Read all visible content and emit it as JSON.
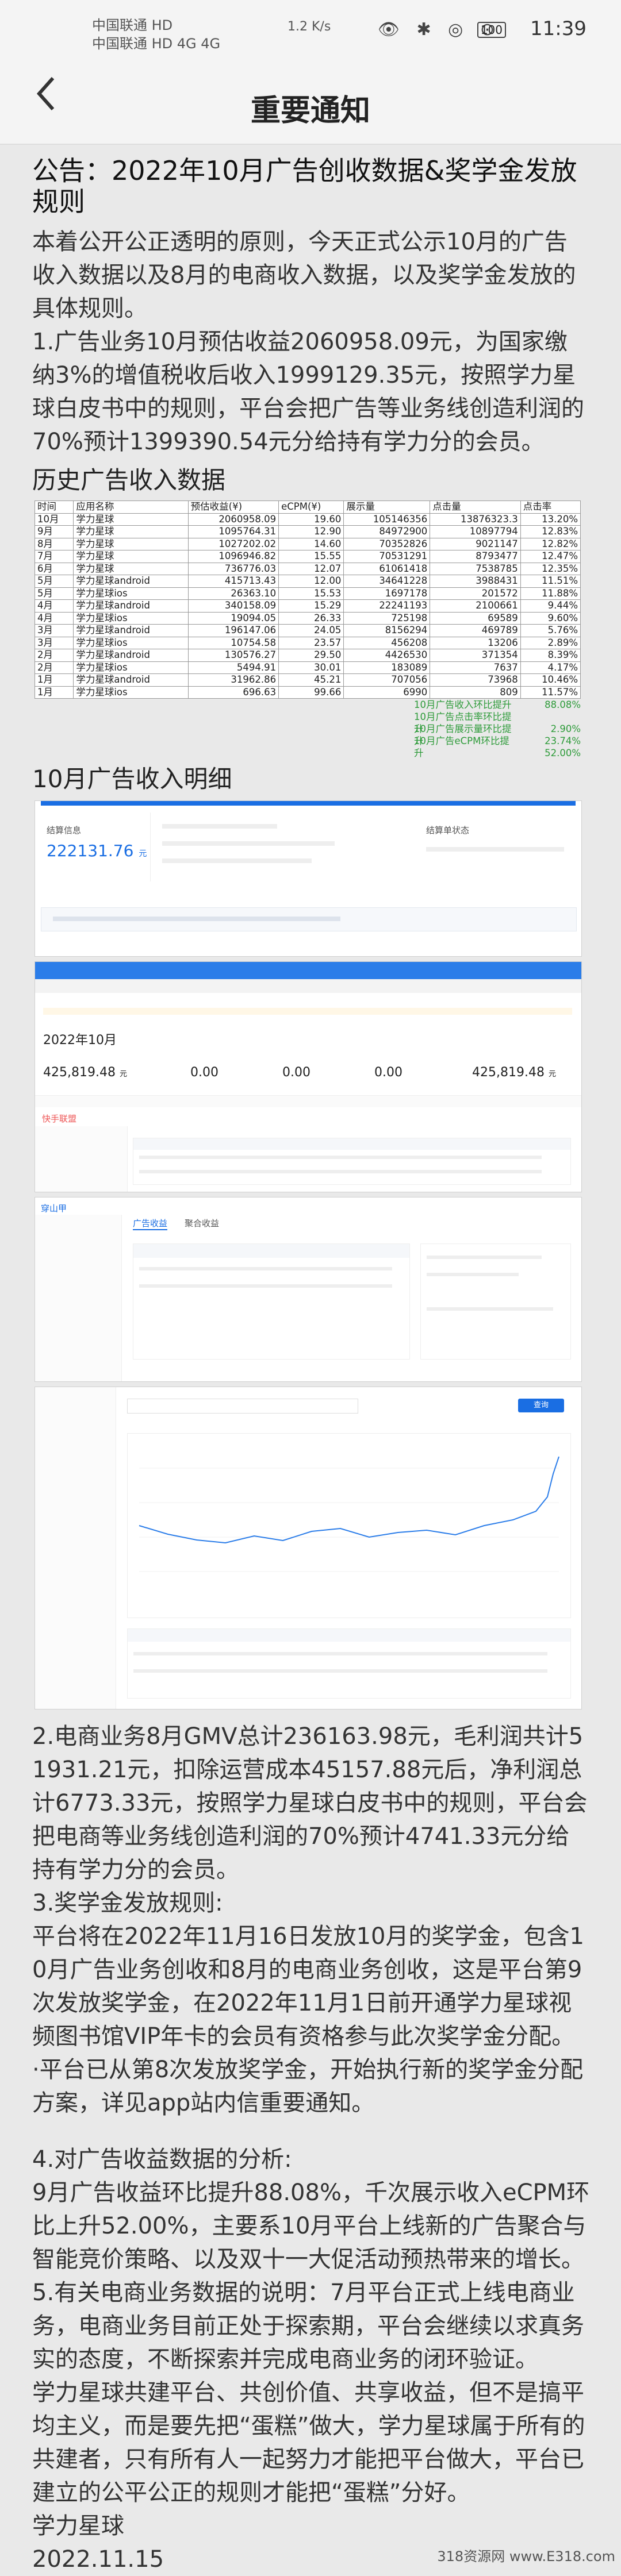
{
  "status_bar": {
    "carrier1": "中国联通 HD",
    "carrier2": "中国联通 HD 4G 4G",
    "speed": "1.2 K/s",
    "icons_text": "👁 ✱ ◎ ⊙",
    "battery": "100",
    "time": "11:39"
  },
  "nav": {
    "title": "重要通知",
    "back_icon": "chevron-left-icon"
  },
  "article": {
    "headline": "公告：2022年10月广告创收数据&奖学金发放规则",
    "p1": "本着公开公正透明的原则，今天正式公示10月的广告收入数据以及8月的电商收入数据，以及奖学金发放的具体规则。",
    "p2": "1.广告业务10月预估收益2060958.09元，为国家缴纳3%的增值税收后收入1999129.35元，按照学力星球白皮书中的规则，平台会把广告等业务线创造利润的70%预计1399390.54元分给持有学力分的会员。",
    "hist_label": "历史广告收入数据",
    "detail_label": "10月广告收入明细",
    "p3": "2.电商业务8月GMV总计236163.98元，毛利润共计51931.21元，扣除运营成本45157.88元后，净利润总计6773.33元，按照学力星球白皮书中的规则，平台会把电商等业务线创造利润的70%预计4741.33元分给持有学力分的会员。",
    "p4_title": "3.奖学金发放规则:",
    "p4": "平台将在2022年11月16日发放10月的奖学金，包含10月广告业务创收和8月的电商业务创收，这是平台第9次发放奖学金，在2022年11月1日前开通学力星球视频图书馆VIP年卡的会员有资格参与此次奖学金分配。",
    "p5": "·平台已从第8次发放奖学金，开始执行新的奖学金分配方案，详见app站内信重要通知。",
    "p6_title": "4.对广告收益数据的分析:",
    "p6": "9月广告收益环比提升88.08%，千次展示收入eCPM环比上升52.00%，主要系10月平台上线新的广告聚合与智能竞价策略、以及双十一大促活动预热带来的增长。",
    "p7": "5.有关电商业务数据的说明：7月平台正式上线电商业务，电商业务目前正处于探索期，平台会继续以求真务实的态度，不断探索并完成电商业务的闭环验证。",
    "p8": "学力星球共建平台、共创价值、共享收益，但不是搞平均主义，而是要先把“蛋糕”做大，学力星球属于所有的共建者，只有所有人一起努力才能把平台做大，平台已建立的公平公正的规则才能把“蛋糕”分好。",
    "sign_org": "学力星球",
    "sign_date": "2022.11.15"
  },
  "history_table": {
    "headers": [
      "时间",
      "应用名称",
      "预估收益(¥)",
      "eCPM(¥)",
      "展示量",
      "点击量",
      "点击率"
    ],
    "rows": [
      [
        "10月",
        "学力星球",
        "2060958.09",
        "19.60",
        "105146356",
        "13876323.3",
        "13.20%"
      ],
      [
        "9月",
        "学力星球",
        "1095764.31",
        "12.90",
        "84972900",
        "10897794",
        "12.83%"
      ],
      [
        "8月",
        "学力星球",
        "1027202.02",
        "14.60",
        "70352826",
        "9021147",
        "12.82%"
      ],
      [
        "7月",
        "学力星球",
        "1096946.82",
        "15.55",
        "70531291",
        "8793477",
        "12.47%"
      ],
      [
        "6月",
        "学力星球",
        "736776.03",
        "12.07",
        "61061418",
        "7538785",
        "12.35%"
      ],
      [
        "5月",
        "学力星球android",
        "415713.43",
        "12.00",
        "34641228",
        "3988431",
        "11.51%"
      ],
      [
        "5月",
        "学力星球ios",
        "26363.10",
        "15.53",
        "1697178",
        "201572",
        "11.88%"
      ],
      [
        "4月",
        "学力星球android",
        "340158.09",
        "15.29",
        "22241193",
        "2100661",
        "9.44%"
      ],
      [
        "4月",
        "学力星球ios",
        "19094.05",
        "26.33",
        "725198",
        "69589",
        "9.60%"
      ],
      [
        "3月",
        "学力星球android",
        "196147.06",
        "24.05",
        "8156294",
        "469789",
        "5.76%"
      ],
      [
        "3月",
        "学力星球ios",
        "10754.58",
        "23.57",
        "456208",
        "13206",
        "2.89%"
      ],
      [
        "2月",
        "学力星球android",
        "130576.27",
        "29.50",
        "4426530",
        "371354",
        "8.39%"
      ],
      [
        "2月",
        "学力星球ios",
        "5494.91",
        "30.01",
        "183089",
        "7637",
        "4.17%"
      ],
      [
        "1月",
        "学力星球android",
        "31962.86",
        "45.21",
        "707056",
        "73968",
        "10.46%"
      ],
      [
        "1月",
        "学力星球ios",
        "696.63",
        "99.66",
        "6990",
        "809",
        "11.57%"
      ]
    ],
    "growth": [
      {
        "label": "10月广告收入环比提升",
        "value": "88.08%"
      },
      {
        "label": "10月广告点击率环比提升",
        "value": "2.90%"
      },
      {
        "label": "10月广告展示量环比提升",
        "value": "23.74%"
      },
      {
        "label": "10月广告eCPM环比提升",
        "value": "52.00%"
      }
    ]
  },
  "shots": {
    "s1": {
      "label": "结算信息",
      "amount": "222131.76",
      "unit": "元",
      "right_title": "结算单状态"
    },
    "s2": {
      "title": "2022年10月",
      "amount1": "425,819.48",
      "unit": "元",
      "zero1": "0.00",
      "zero2": "0.00",
      "zero3": "0.00",
      "amount2": "425,819.48"
    },
    "s3": {
      "brand": "快手联盟"
    },
    "s4": {
      "brand": "穿山甲",
      "tab1": "广告收益",
      "tab2": "聚合收益",
      "btn": "查询"
    },
    "watermark": "318资源网 www.E318.com"
  }
}
